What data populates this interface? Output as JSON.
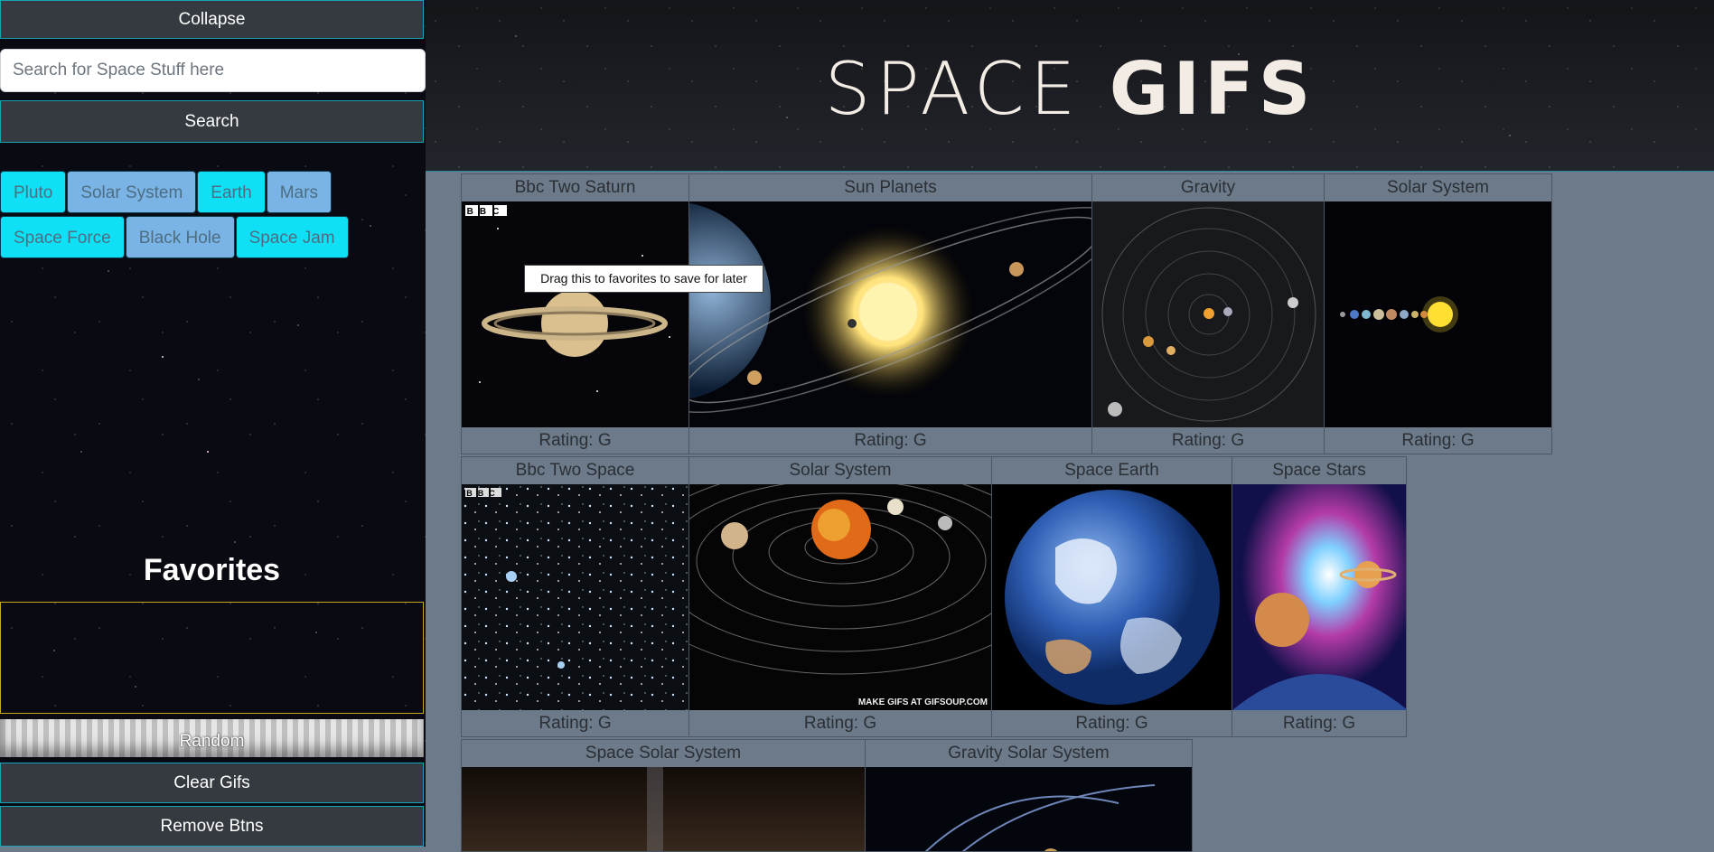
{
  "sidebar": {
    "collapse_label": "Collapse",
    "search_placeholder": "Search for Space Stuff here",
    "search_label": "Search",
    "topics": [
      {
        "label": "Pluto",
        "color": "#0fe0f5"
      },
      {
        "label": "Solar System",
        "color": "#7ab4e6"
      },
      {
        "label": "Earth",
        "color": "#0fe0f5"
      },
      {
        "label": "Mars",
        "color": "#7ab4e6"
      },
      {
        "label": "Space Force",
        "color": "#0fe0f5"
      },
      {
        "label": "Black Hole",
        "color": "#7ab4e6"
      },
      {
        "label": "Space Jam",
        "color": "#0fe0f5"
      }
    ],
    "favorites_title": "Favorites",
    "random_label": "Random",
    "clear_label": "Clear Gifs",
    "remove_label": "Remove Btns"
  },
  "header": {
    "title_light": "SPACE",
    "title_bold": "GIFS"
  },
  "tooltip": "Drag this to favorites to save for later",
  "gifs": [
    {
      "title": "Bbc Two Saturn",
      "rating": "Rating: G",
      "image": "saturn"
    },
    {
      "title": "Sun Planets",
      "rating": "Rating: G",
      "image": "sun-planets"
    },
    {
      "title": "Gravity",
      "rating": "Rating: G",
      "image": "gravity"
    },
    {
      "title": "Solar System",
      "rating": "Rating: G",
      "image": "planet-line"
    },
    {
      "title": "Bbc Two Space",
      "rating": "Rating: G",
      "image": "starfield"
    },
    {
      "title": "Solar System",
      "rating": "Rating: G",
      "image": "orbits"
    },
    {
      "title": "Space Earth",
      "rating": "Rating: G",
      "image": "earth"
    },
    {
      "title": "Space Stars",
      "rating": "Rating: G",
      "image": "nebula"
    },
    {
      "title": "Space Solar System",
      "rating": "",
      "image": "dark"
    },
    {
      "title": "Gravity Solar System",
      "rating": "",
      "image": "dark-orbit"
    }
  ],
  "watermark_bbc": "BBC",
  "watermark_gifsoup": "MAKE GIFS AT GIFSOUP.COM"
}
